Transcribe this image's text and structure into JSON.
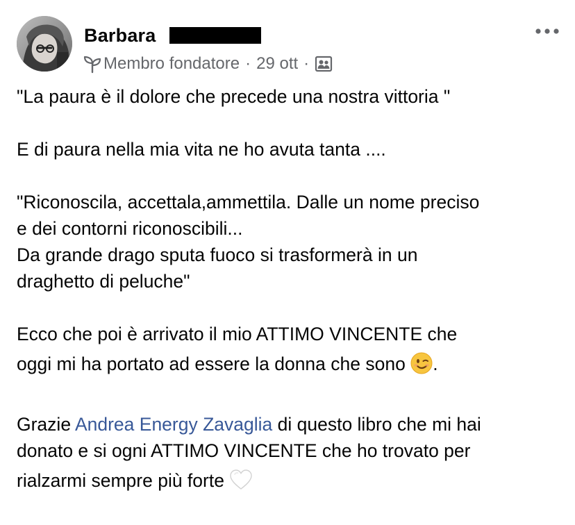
{
  "author": {
    "name": "Barbara",
    "badge_label": "Membro fondatore",
    "timestamp": "29 ott",
    "separator": "·",
    "badge_icon": "sprout-icon",
    "audience_icon": "group-icon"
  },
  "actions": {
    "more_icon": "more-horizontal-icon"
  },
  "post": {
    "line_1": "\"La paura è il dolore che precede una nostra vittoria \"",
    "line_2": "E di paura nella mia vita ne ho avuta tanta ....",
    "line_3": "\"Riconoscila, accettala,ammettila. Dalle un nome preciso",
    "line_4": "e dei contorni riconoscibili...",
    "line_5": "Da grande drago sputa fuoco si trasformerà in un",
    "line_6": "draghetto di peluche\"",
    "line_7": "Ecco che poi è arrivato il mio ATTIMO VINCENTE che",
    "line_8": "oggi mi ha portato ad essere la donna che sono",
    "line_8_end": ".",
    "line_9_prefix": "Grazie ",
    "mention": "Andrea Energy Zavaglia",
    "line_9_suffix": " di questo libro che mi hai",
    "line_10": "donato e si ogni ATTIMO VINCENTE che ho trovato per",
    "line_11": "rialzarmi sempre più forte",
    "emoji_wink": "winking-face-emoji",
    "emoji_heart": "white-heart-emoji"
  }
}
